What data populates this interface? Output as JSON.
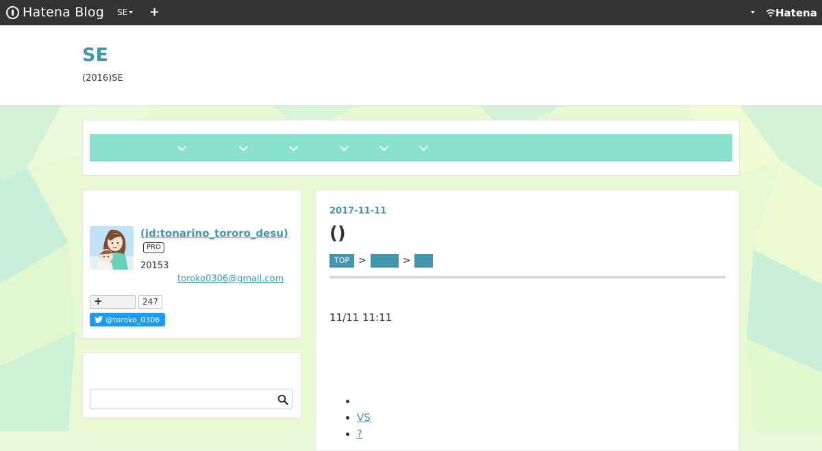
{
  "topbar": {
    "logo_text": "Hatena Blog",
    "blog_switch_label": "SE",
    "add_label": "+",
    "brand_text": "Hatena"
  },
  "header": {
    "title": "SE",
    "description": "(2016)SE"
  },
  "nav": {
    "items": [
      "",
      "",
      "",
      "",
      "",
      ""
    ]
  },
  "profile": {
    "name": " (id:tonarino_tororo_desu)",
    "badge": "PRO",
    "since": "20153",
    "email": "toroko0306@gmail.com",
    "reader_count": "247",
    "twitter_handle": "@toroko_0306"
  },
  "search": {
    "placeholder": ""
  },
  "article": {
    "date": "2017-11-11",
    "title": "()",
    "breadcrumbs": [
      "TOP",
      "",
      ""
    ],
    "crumb_separator": ">",
    "time": "11/11 11:11",
    "toc": [
      "",
      "VS",
      "?"
    ]
  },
  "colors": {
    "accent": "#4396b0",
    "nav_bar": "#88e0cf",
    "topbar": "#333333",
    "twitter": "#1d9bf0"
  }
}
